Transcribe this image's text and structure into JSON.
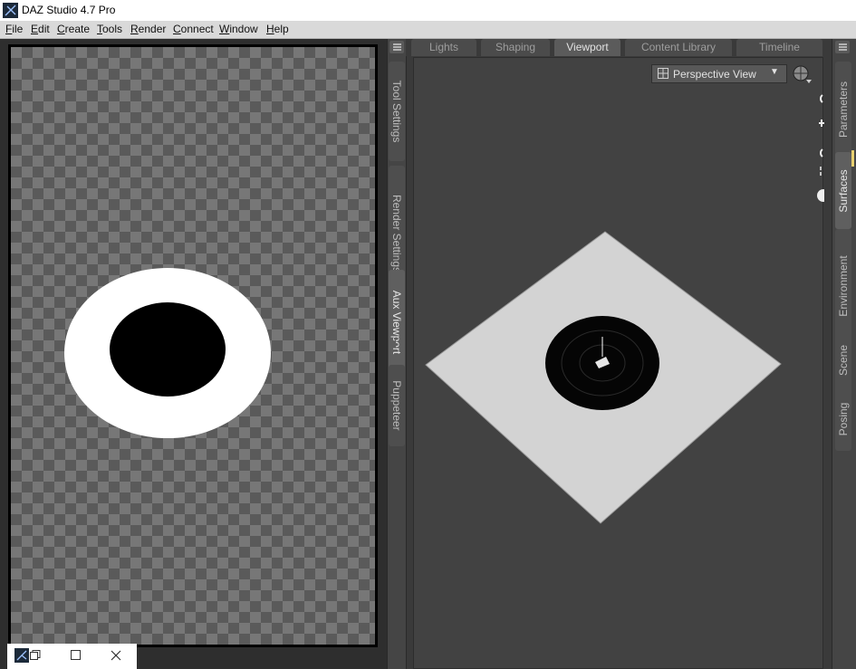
{
  "window": {
    "title": "DAZ Studio 4.7 Pro"
  },
  "menu": [
    "File",
    "Edit",
    "Create",
    "Tools",
    "Render",
    "Connect",
    "Window",
    "Help"
  ],
  "left_tabs": [
    "Tool Settings",
    "Render Settings",
    "Aux Viewport",
    "Puppeteer"
  ],
  "top_tabs": [
    "Lights",
    "Shaping",
    "Viewport",
    "Content Library",
    "Timeline"
  ],
  "active_top_tab": "Viewport",
  "viewport": {
    "camera_select": "Perspective View"
  },
  "right_tabs": [
    "Parameters",
    "Surfaces",
    "Environment",
    "Scene",
    "Posing"
  ],
  "icons": {
    "app": "daz-logo-icon",
    "view_select": "grid-view-icon",
    "dropdown": "chevron-down-icon",
    "shading": "sphere-shading-icon",
    "panel_menu": "panel-menu-icon",
    "tray_restore": "restore-icon",
    "tray_maximize": "maximize-icon",
    "tray_close": "close-icon"
  }
}
